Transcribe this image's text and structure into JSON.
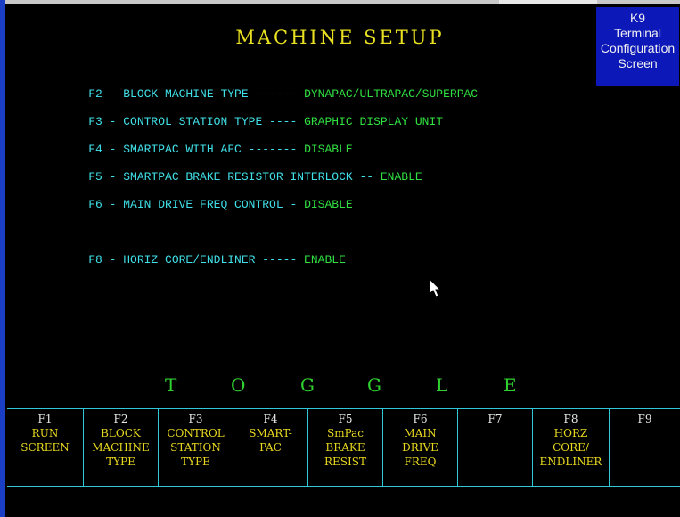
{
  "screen": {
    "title": "MACHINE SETUP",
    "k9": {
      "line1": "K9",
      "line2": "Terminal",
      "line3": "Configuration",
      "line4": "Screen"
    }
  },
  "settings": [
    {
      "label": "F2 - BLOCK MACHINE TYPE ------ ",
      "value": "DYNAPAC/ULTRAPAC/SUPERPAC"
    },
    {
      "label": "F3 - CONTROL STATION TYPE ---- ",
      "value": "GRAPHIC DISPLAY UNIT"
    },
    {
      "label": "F4 - SMARTPAC WITH AFC ------- ",
      "value": "DISABLE"
    },
    {
      "label": "F5 - SMARTPAC BRAKE RESISTOR INTERLOCK -- ",
      "value": "ENABLE"
    },
    {
      "label": "F6 - MAIN DRIVE FREQ CONTROL - ",
      "value": "DISABLE"
    },
    {
      "label": "F8 - HORIZ CORE/ENDLINER ----- ",
      "value": "ENABLE"
    }
  ],
  "toggle_letters": [
    "T",
    "O",
    "G",
    "G",
    "L",
    "E"
  ],
  "fkeys": [
    {
      "num": "F1",
      "text": "RUN\nSCREEN"
    },
    {
      "num": "F2",
      "text": "BLOCK\nMACHINE\nTYPE"
    },
    {
      "num": "F3",
      "text": "CONTROL\nSTATION\nTYPE"
    },
    {
      "num": "F4",
      "text": "SMART-\nPAC"
    },
    {
      "num": "F5",
      "text": "SmPac\nBRAKE\nRESIST"
    },
    {
      "num": "F6",
      "text": "MAIN\nDRIVE\nFREQ"
    },
    {
      "num": "F7",
      "text": ""
    },
    {
      "num": "F8",
      "text": "HORZ\nCORE/\nENDLINER"
    },
    {
      "num": "F9",
      "text": ""
    }
  ],
  "colors": {
    "label": "#40e0e8",
    "value": "#30e040",
    "title": "#e8e020",
    "k9_bg": "#0c18b8",
    "border": "#30c8d8"
  }
}
